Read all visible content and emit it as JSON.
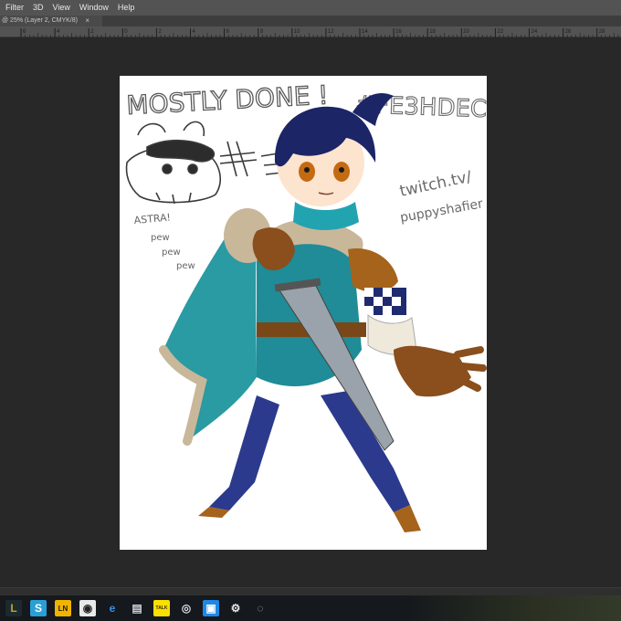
{
  "menubar": {
    "items": [
      {
        "label": "Filter"
      },
      {
        "label": "3D"
      },
      {
        "label": "View"
      },
      {
        "label": "Window"
      },
      {
        "label": "Help"
      }
    ]
  },
  "document_tab": {
    "title": "@ 25% (Layer 2, CMYK/8)",
    "close_glyph": "×"
  },
  "ruler": {
    "labels": [
      "6",
      "4",
      "2",
      "0",
      "2",
      "4",
      "6",
      "8",
      "10",
      "12",
      "14",
      "16",
      "18",
      "20",
      "22",
      "24",
      "26",
      "28"
    ]
  },
  "artwork": {
    "title_left": "MOSTLY DONE !",
    "title_right": "#FE3HDECK",
    "twitch_line1": "twitch.tv/",
    "twitch_line2": "puppyshafier",
    "astra": "ASTRA!",
    "pew1": "pew",
    "pew2": "pew",
    "pew3": "pew"
  },
  "taskbar": {
    "icons": [
      {
        "name": "league-icon",
        "glyph": "L",
        "bg": "#1b2a2e",
        "fg": "#c9a227"
      },
      {
        "name": "sketch-app-icon",
        "glyph": "S",
        "bg": "#2a9fd6",
        "fg": "#ffffff"
      },
      {
        "name": "ln-app-icon",
        "glyph": "LN",
        "bg": "#f0b400",
        "fg": "#1a1a1a"
      },
      {
        "name": "obs-like-icon",
        "glyph": "◉",
        "bg": "#e9e9e9",
        "fg": "#222222"
      },
      {
        "name": "edge-icon",
        "glyph": "e",
        "bg": "#15181c",
        "fg": "#3b8fe6"
      },
      {
        "name": "scanner-icon",
        "glyph": "▤",
        "bg": "#15181c",
        "fg": "#cfd6dc"
      },
      {
        "name": "kakaotalk-icon",
        "glyph": "TALK",
        "bg": "#f9e000",
        "fg": "#3a2a00"
      },
      {
        "name": "steam-icon",
        "glyph": "◎",
        "bg": "#15181c",
        "fg": "#d6dde3"
      },
      {
        "name": "box-app-icon",
        "glyph": "▣",
        "bg": "#1e88e5",
        "fg": "#ffffff"
      },
      {
        "name": "settings-icon",
        "glyph": "⚙",
        "bg": "#15181c",
        "fg": "#e6e6e6"
      },
      {
        "name": "obs-icon",
        "glyph": "◌",
        "bg": "#15181c",
        "fg": "#b8b8b8"
      }
    ]
  }
}
